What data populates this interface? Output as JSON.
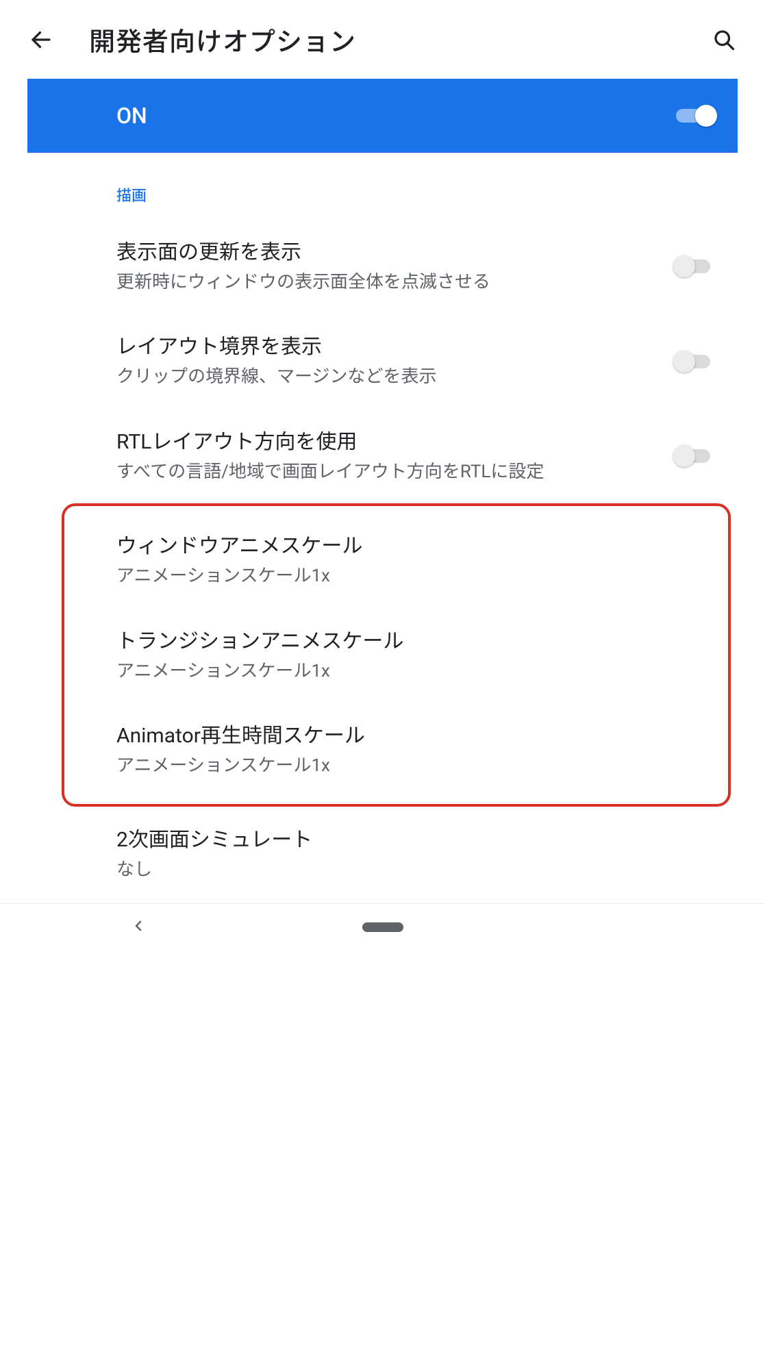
{
  "header": {
    "title": "開発者向けオプション"
  },
  "masterToggle": {
    "label": "ON",
    "on": true
  },
  "section": {
    "label": "描画"
  },
  "rows": [
    {
      "title": "表示面の更新を表示",
      "sub": "更新時にウィンドウの表示面全体を点滅させる",
      "hasSwitch": true,
      "switchOn": false
    },
    {
      "title": "レイアウト境界を表示",
      "sub": "クリップの境界線、マージンなどを表示",
      "hasSwitch": true,
      "switchOn": false
    },
    {
      "title": "RTLレイアウト方向を使用",
      "sub": "すべての言語/地域で画面レイアウト方向をRTLに設定",
      "hasSwitch": true,
      "switchOn": false
    },
    {
      "title": "ウィンドウアニメスケール",
      "sub": "アニメーションスケール1x",
      "hasSwitch": false
    },
    {
      "title": "トランジションアニメスケール",
      "sub": "アニメーションスケール1x",
      "hasSwitch": false
    },
    {
      "title": "Animator再生時間スケール",
      "sub": "アニメーションスケール1x",
      "hasSwitch": false
    },
    {
      "title": "2次画面シミュレート",
      "sub": "なし",
      "hasSwitch": false
    }
  ]
}
